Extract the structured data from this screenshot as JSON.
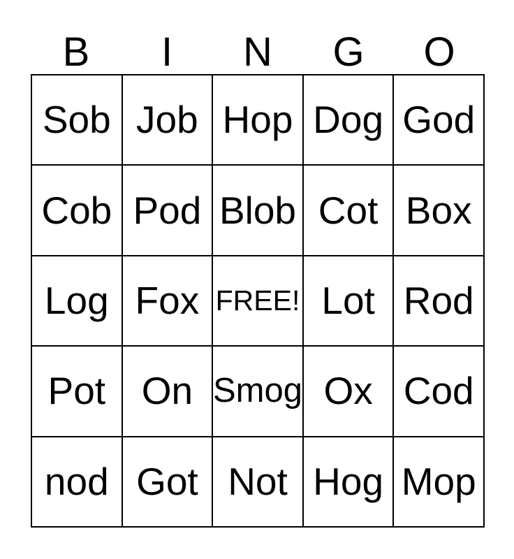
{
  "card": {
    "title": "BINGO",
    "columns": [
      "B",
      "I",
      "N",
      "G",
      "O"
    ],
    "free_space_label": "FREE!",
    "text_color": "#000000",
    "background_color": "#ffffff",
    "grid_line_color": "#000000",
    "rows": 5,
    "cols": 5,
    "cells": [
      [
        {
          "label": "Sob",
          "size": "normal"
        },
        {
          "label": "Job",
          "size": "normal"
        },
        {
          "label": "Hop",
          "size": "normal"
        },
        {
          "label": "Dog",
          "size": "normal"
        },
        {
          "label": "God",
          "size": "normal"
        }
      ],
      [
        {
          "label": "Cob",
          "size": "normal"
        },
        {
          "label": "Pod",
          "size": "normal"
        },
        {
          "label": "Blob",
          "size": "normal"
        },
        {
          "label": "Cot",
          "size": "normal"
        },
        {
          "label": "Box",
          "size": "normal"
        }
      ],
      [
        {
          "label": "Log",
          "size": "normal"
        },
        {
          "label": "Fox",
          "size": "normal"
        },
        {
          "label": "FREE!",
          "size": "small",
          "free": true
        },
        {
          "label": "Lot",
          "size": "normal"
        },
        {
          "label": "Rod",
          "size": "normal"
        }
      ],
      [
        {
          "label": "Pot",
          "size": "normal"
        },
        {
          "label": "On",
          "size": "normal"
        },
        {
          "label": "Smog",
          "size": "medium"
        },
        {
          "label": "Ox",
          "size": "normal"
        },
        {
          "label": "Cod",
          "size": "normal"
        }
      ],
      [
        {
          "label": "nod",
          "size": "normal"
        },
        {
          "label": "Got",
          "size": "normal"
        },
        {
          "label": "Not",
          "size": "normal"
        },
        {
          "label": "Hog",
          "size": "normal"
        },
        {
          "label": "Mop",
          "size": "normal"
        }
      ]
    ]
  }
}
